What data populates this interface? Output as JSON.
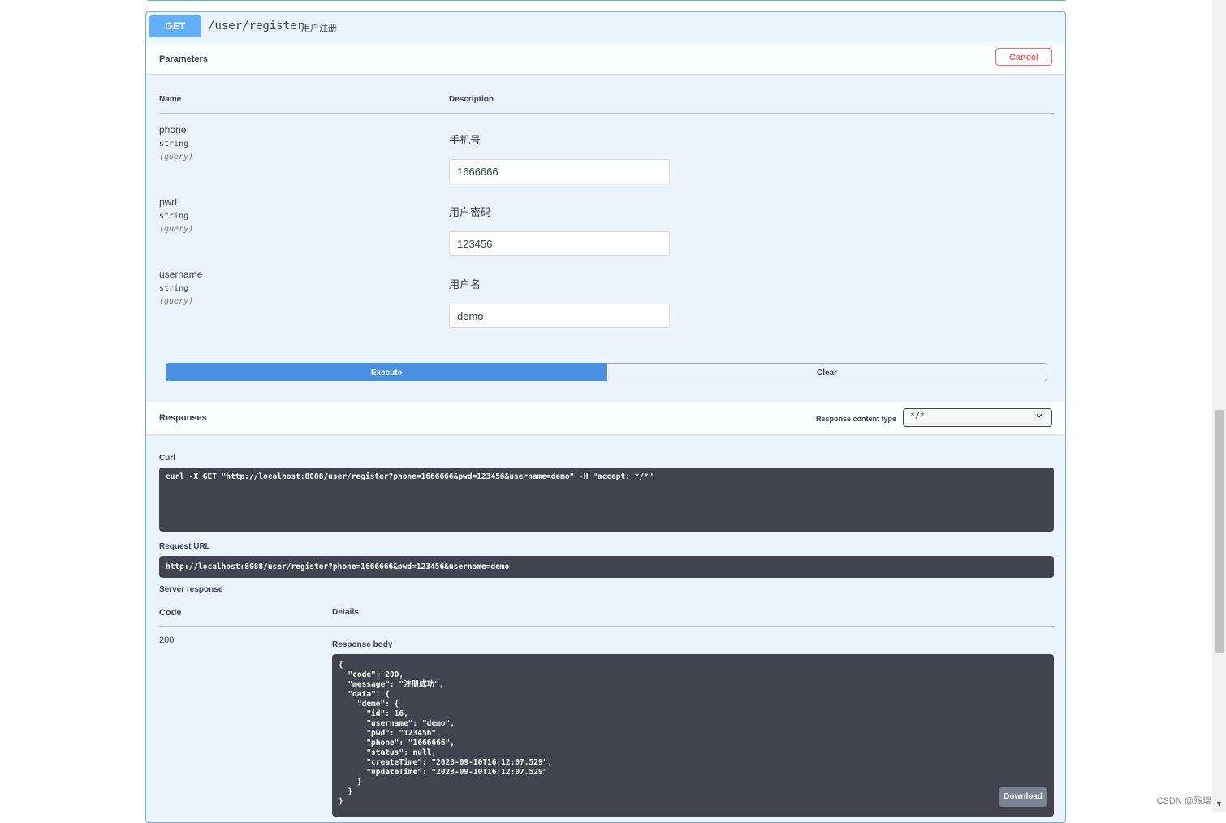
{
  "operation": {
    "method": "GET",
    "path": "/user/register",
    "summary": "用户注册"
  },
  "parameters": {
    "title": "Parameters",
    "cancel_label": "Cancel",
    "col_name": "Name",
    "col_description": "Description",
    "items": [
      {
        "name": "phone",
        "type": "string",
        "in": "(query)",
        "description": "手机号",
        "value": "1666666"
      },
      {
        "name": "pwd",
        "type": "string",
        "in": "(query)",
        "description": "用户密码",
        "value": "123456"
      },
      {
        "name": "username",
        "type": "string",
        "in": "(query)",
        "description": "用户名",
        "value": "demo"
      }
    ]
  },
  "actions": {
    "execute_label": "Execute",
    "clear_label": "Clear"
  },
  "responses": {
    "title": "Responses",
    "content_type_label": "Response content type",
    "content_type_value": "*/*",
    "curl_label": "Curl",
    "curl_command": "curl -X GET \"http://localhost:8088/user/register?phone=1666666&pwd=123456&username=demo\" -H \"accept: */*\"",
    "request_url_label": "Request URL",
    "request_url": "http://localhost:8088/user/register?phone=1666666&pwd=123456&username=demo",
    "server_response_label": "Server response",
    "col_code": "Code",
    "col_details": "Details",
    "code": "200",
    "response_body_label": "Response body",
    "response_body": "{\n  \"code\": 200,\n  \"message\": \"注册成功\",\n  \"data\": {\n    \"demo\": {\n      \"id\": 16,\n      \"username\": \"demo\",\n      \"pwd\": \"123456\",\n      \"phone\": \"1666666\",\n      \"status\": null,\n      \"createTime\": \"2023-09-10T16:12:07.529\",\n      \"updateTime\": \"2023-09-10T16:12:07.529\"\n    }\n  }\n}",
    "download_label": "Download"
  },
  "watermark": "CSDN @殇璃",
  "colors": {
    "get_accent": "#61affe",
    "execute": "#4990e2",
    "cancel": "#ff6060",
    "code_bg": "#41444e"
  }
}
